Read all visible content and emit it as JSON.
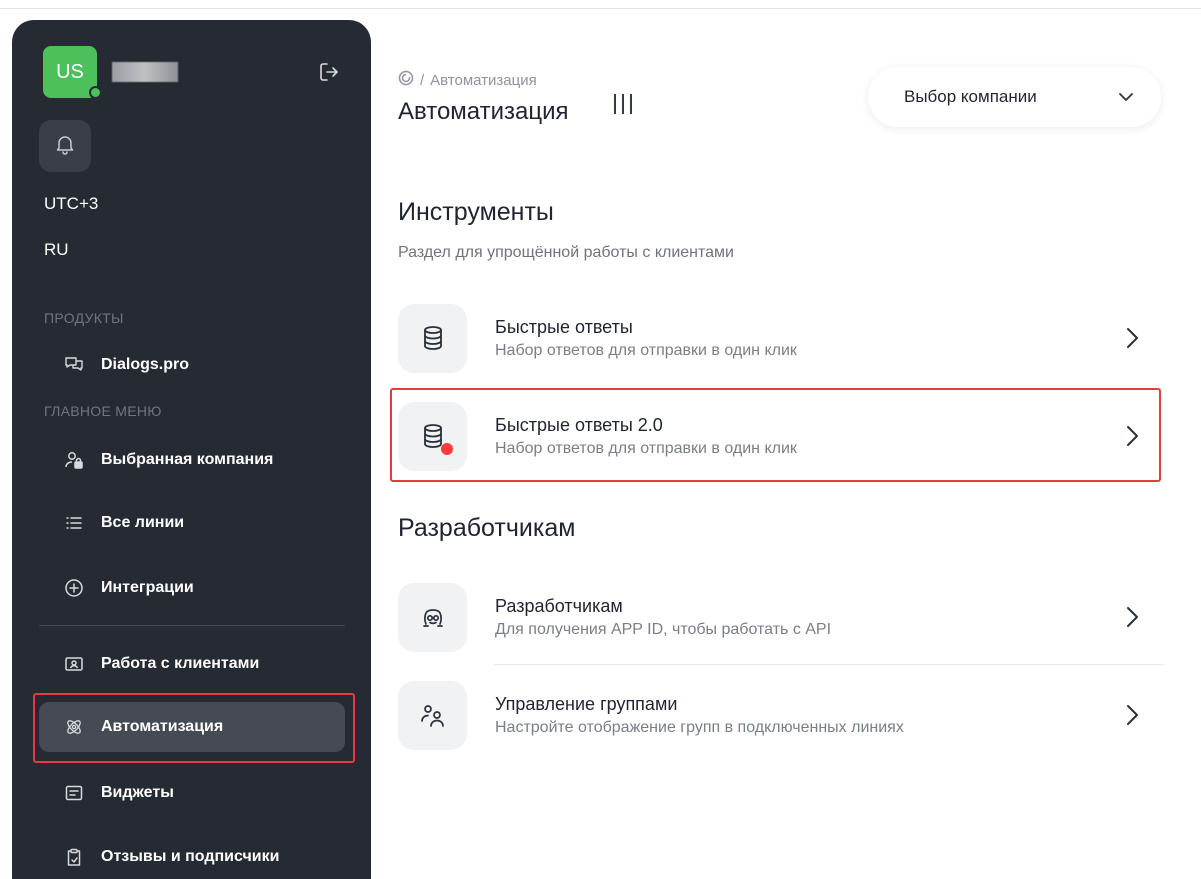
{
  "sidebar": {
    "avatar_initials": "US",
    "timezone": "UTC+3",
    "language": "RU",
    "section_products": "ПРОДУКТЫ",
    "section_main_menu": "ГЛАВНОЕ МЕНЮ",
    "product_item": "Dialogs.pro",
    "items": [
      {
        "label": "Выбранная компания",
        "icon": "user-lock-icon"
      },
      {
        "label": "Все линии",
        "icon": "list-icon"
      },
      {
        "label": "Интеграции",
        "icon": "plus-circle-icon"
      },
      {
        "label": "Работа с клиентами",
        "icon": "contact-card-icon"
      },
      {
        "label": "Автоматизация",
        "icon": "automation-icon"
      },
      {
        "label": "Виджеты",
        "icon": "widget-icon"
      },
      {
        "label": "Отзывы и подписчики",
        "icon": "clipboard-icon"
      }
    ],
    "active_item": "Автоматизация",
    "accent_color": "#4cc05a"
  },
  "header": {
    "breadcrumb_current": "Автоматизация",
    "title": "Автоматизация",
    "company_select_value": "Выбор компании"
  },
  "tools": {
    "heading": "Инструменты",
    "description": "Раздел для упрощённой работы с клиентами",
    "cards": [
      {
        "title": "Быстрые ответы",
        "subtitle": "Набор ответов для отправки в один клик",
        "icon": "database-icon"
      },
      {
        "title": "Быстрые ответы 2.0",
        "subtitle": "Набор ответов для отправки в один клик",
        "icon": "database-badge-icon"
      }
    ]
  },
  "developers": {
    "heading": "Разработчикам",
    "cards": [
      {
        "title": "Разработчикам",
        "subtitle": "Для получения APP ID, чтобы работать с API",
        "icon": "developer-icon"
      },
      {
        "title": "Управление группами",
        "subtitle": "Настройте отображение групп в подключенных линиях",
        "icon": "users-group-icon"
      }
    ]
  },
  "highlight_color": "#e23c3c"
}
